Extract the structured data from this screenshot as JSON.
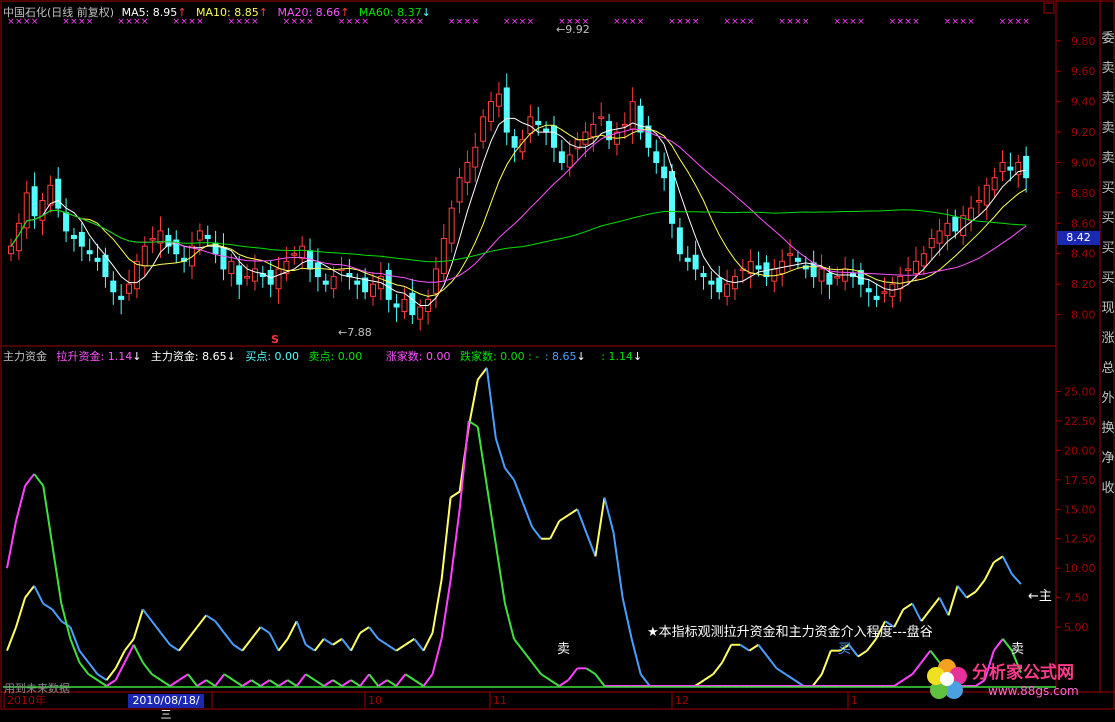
{
  "top_header": {
    "title": "中国石化(日线 前复权)",
    "ma5": "MA5: 8.95",
    "ma10": "MA10: 8.85",
    "ma20": "MA20: 8.66",
    "ma60": "MA60: 8.37"
  },
  "bottom_header": {
    "name": "主力资金",
    "lift": "拉升资金: 1.14",
    "main": "主力资金: 8.65",
    "buy": "买点: 0.00",
    "sell": "卖点: 0.00",
    "up": "涨家数: 0.00",
    "down": "跌家数: 0.00 : -",
    "v1": ": 8.65",
    "v2": ": 1.14"
  },
  "annotations": {
    "high": "9.92",
    "low": "7.88",
    "s_mark": "S",
    "sell1": "卖",
    "buy1": "买",
    "sell2": "卖",
    "main_tag": "主",
    "note": "★本指标观测拉升资金和主力资金介入程度---盘谷",
    "current_price": "8.42",
    "date_box": "2010/08/18/三",
    "bottom_left": "用到未来数据",
    "logo_text": "分析家公式网",
    "logo_url": "www.88gs.com"
  },
  "side_text": [
    "委",
    "卖",
    "卖",
    "卖",
    "卖",
    "买",
    "买",
    "买",
    "买",
    "现",
    "涨",
    "总",
    "外",
    "换",
    "净",
    "收"
  ],
  "colors": {
    "up": "#ff3c3c",
    "down": "#54ffff",
    "ma5": "#ffffff",
    "ma10": "#ffff54",
    "ma20": "#ff54ff",
    "ma60": "#00e000",
    "main_yellow": "#ffff66",
    "main_blue": "#4a9eff",
    "lift_magenta": "#ff40ff",
    "lift_green": "#40e040",
    "axis": "#a00000"
  },
  "chart_data": [
    {
      "type": "candlestick",
      "title": "中国石化(日线 前复权)",
      "y_axis": {
        "ticks": [
          8.0,
          8.2,
          8.4,
          8.6,
          8.8,
          9.0,
          9.2,
          9.4,
          9.6,
          9.8
        ],
        "range": [
          7.8,
          9.95
        ]
      },
      "x_ticks": [
        "2010年",
        "9",
        "10",
        "11",
        "12",
        "1"
      ],
      "high": 9.92,
      "low": 7.88,
      "close": [
        8.45,
        8.6,
        8.8,
        8.65,
        8.75,
        8.85,
        8.7,
        8.55,
        8.5,
        8.45,
        8.4,
        8.35,
        8.25,
        8.15,
        8.1,
        8.2,
        8.35,
        8.45,
        8.5,
        8.55,
        8.45,
        8.4,
        8.35,
        8.45,
        8.55,
        8.5,
        8.4,
        8.3,
        8.35,
        8.2,
        8.25,
        8.3,
        8.25,
        8.2,
        8.3,
        8.35,
        8.4,
        8.45,
        8.3,
        8.25,
        8.2,
        8.25,
        8.3,
        8.25,
        8.2,
        8.15,
        8.2,
        8.25,
        8.1,
        8.05,
        8.1,
        8.0,
        8.05,
        8.1,
        8.3,
        8.5,
        8.7,
        8.9,
        9.0,
        9.1,
        9.3,
        9.4,
        9.45,
        9.2,
        9.1,
        9.15,
        9.3,
        9.25,
        9.2,
        9.1,
        9.0,
        9.05,
        9.15,
        9.2,
        9.25,
        9.3,
        9.15,
        9.2,
        9.25,
        9.4,
        9.2,
        9.1,
        9.0,
        8.9,
        8.6,
        8.4,
        8.35,
        8.3,
        8.25,
        8.2,
        8.15,
        8.2,
        8.25,
        8.3,
        8.35,
        8.3,
        8.25,
        8.3,
        8.35,
        8.4,
        8.35,
        8.3,
        8.25,
        8.3,
        8.2,
        8.25,
        8.3,
        8.25,
        8.2,
        8.15,
        8.1,
        8.15,
        8.2,
        8.25,
        8.3,
        8.35,
        8.4,
        8.5,
        8.55,
        8.6,
        8.55,
        8.65,
        8.7,
        8.75,
        8.85,
        8.9,
        9.0,
        8.95,
        9.0,
        8.9
      ]
    },
    {
      "type": "line",
      "title": "主力资金",
      "y_axis": {
        "ticks": [
          5.0,
          7.5,
          10.0,
          12.5,
          15.0,
          17.5,
          20.0,
          22.5,
          25.0
        ],
        "range": [
          0,
          27.5
        ]
      },
      "x_ticks": [
        "2010年",
        "9",
        "10",
        "11",
        "12",
        "1"
      ],
      "series": [
        {
          "name": "主力资金",
          "values": [
            3.0,
            5.0,
            7.5,
            8.5,
            7.0,
            6.5,
            5.5,
            5.0,
            3.0,
            2.0,
            1.0,
            0.5,
            1.5,
            3.0,
            4.0,
            6.5,
            5.5,
            4.5,
            3.5,
            3.0,
            4.0,
            5.0,
            6.0,
            5.5,
            4.5,
            3.5,
            3.0,
            4.0,
            5.0,
            4.5,
            3.0,
            4.0,
            5.5,
            3.5,
            3.0,
            4.0,
            3.5,
            4.0,
            3.0,
            4.5,
            5.0,
            4.0,
            3.5,
            3.0,
            3.5,
            4.0,
            3.0,
            4.5,
            9.0,
            16.0,
            16.5,
            22.0,
            26.0,
            27.0,
            21.0,
            18.5,
            17.5,
            15.5,
            13.5,
            12.5,
            12.5,
            14.0,
            14.5,
            15.0,
            13.0,
            11.0,
            16.0,
            13.0,
            7.5,
            4.0,
            1.0,
            0.0,
            0.0,
            0.0,
            0.0,
            0.0,
            0.0,
            0.5,
            1.0,
            2.0,
            3.5,
            3.5,
            3.0,
            3.5,
            2.5,
            1.5,
            1.0,
            0.5,
            0.0,
            0.0,
            1.0,
            3.0,
            3.0,
            3.5,
            2.5,
            3.0,
            4.0,
            5.5,
            5.0,
            6.5,
            7.0,
            5.5,
            6.5,
            7.5,
            6.0,
            8.5,
            7.5,
            8.0,
            9.0,
            10.5,
            11.0,
            9.5,
            8.65
          ]
        },
        {
          "name": "拉升资金",
          "values": [
            10.0,
            14.0,
            17.0,
            18.0,
            17.0,
            12.0,
            7.0,
            4.0,
            2.0,
            1.0,
            0.5,
            0.0,
            0.5,
            2.0,
            3.5,
            2.0,
            1.0,
            0.5,
            0.0,
            0.5,
            1.0,
            0.0,
            0.5,
            0.0,
            1.0,
            0.5,
            0.0,
            0.5,
            0.0,
            0.5,
            0.0,
            0.5,
            0.0,
            1.0,
            0.5,
            0.0,
            0.5,
            0.0,
            0.5,
            0.0,
            1.0,
            0.0,
            0.5,
            0.0,
            1.0,
            0.5,
            0.0,
            1.0,
            4.0,
            9.0,
            15.0,
            22.5,
            22.0,
            17.0,
            12.0,
            7.0,
            4.0,
            3.0,
            2.0,
            1.0,
            0.5,
            0.0,
            0.5,
            1.5,
            1.5,
            1.0,
            0.0,
            0.0,
            0.0,
            0.0,
            0.0,
            0.0,
            0.0,
            0.0,
            0.0,
            0.0,
            0.0,
            0.0,
            0.0,
            0.0,
            0.0,
            0.0,
            0.0,
            0.0,
            0.0,
            0.0,
            0.0,
            0.0,
            0.0,
            0.0,
            0.0,
            0.0,
            0.0,
            0.0,
            0.0,
            0.0,
            0.0,
            0.0,
            0.0,
            0.5,
            1.0,
            2.0,
            3.0,
            2.0,
            1.0,
            0.0,
            0.0,
            0.0,
            0.5,
            3.0,
            4.0,
            3.0,
            1.14
          ]
        }
      ]
    }
  ]
}
